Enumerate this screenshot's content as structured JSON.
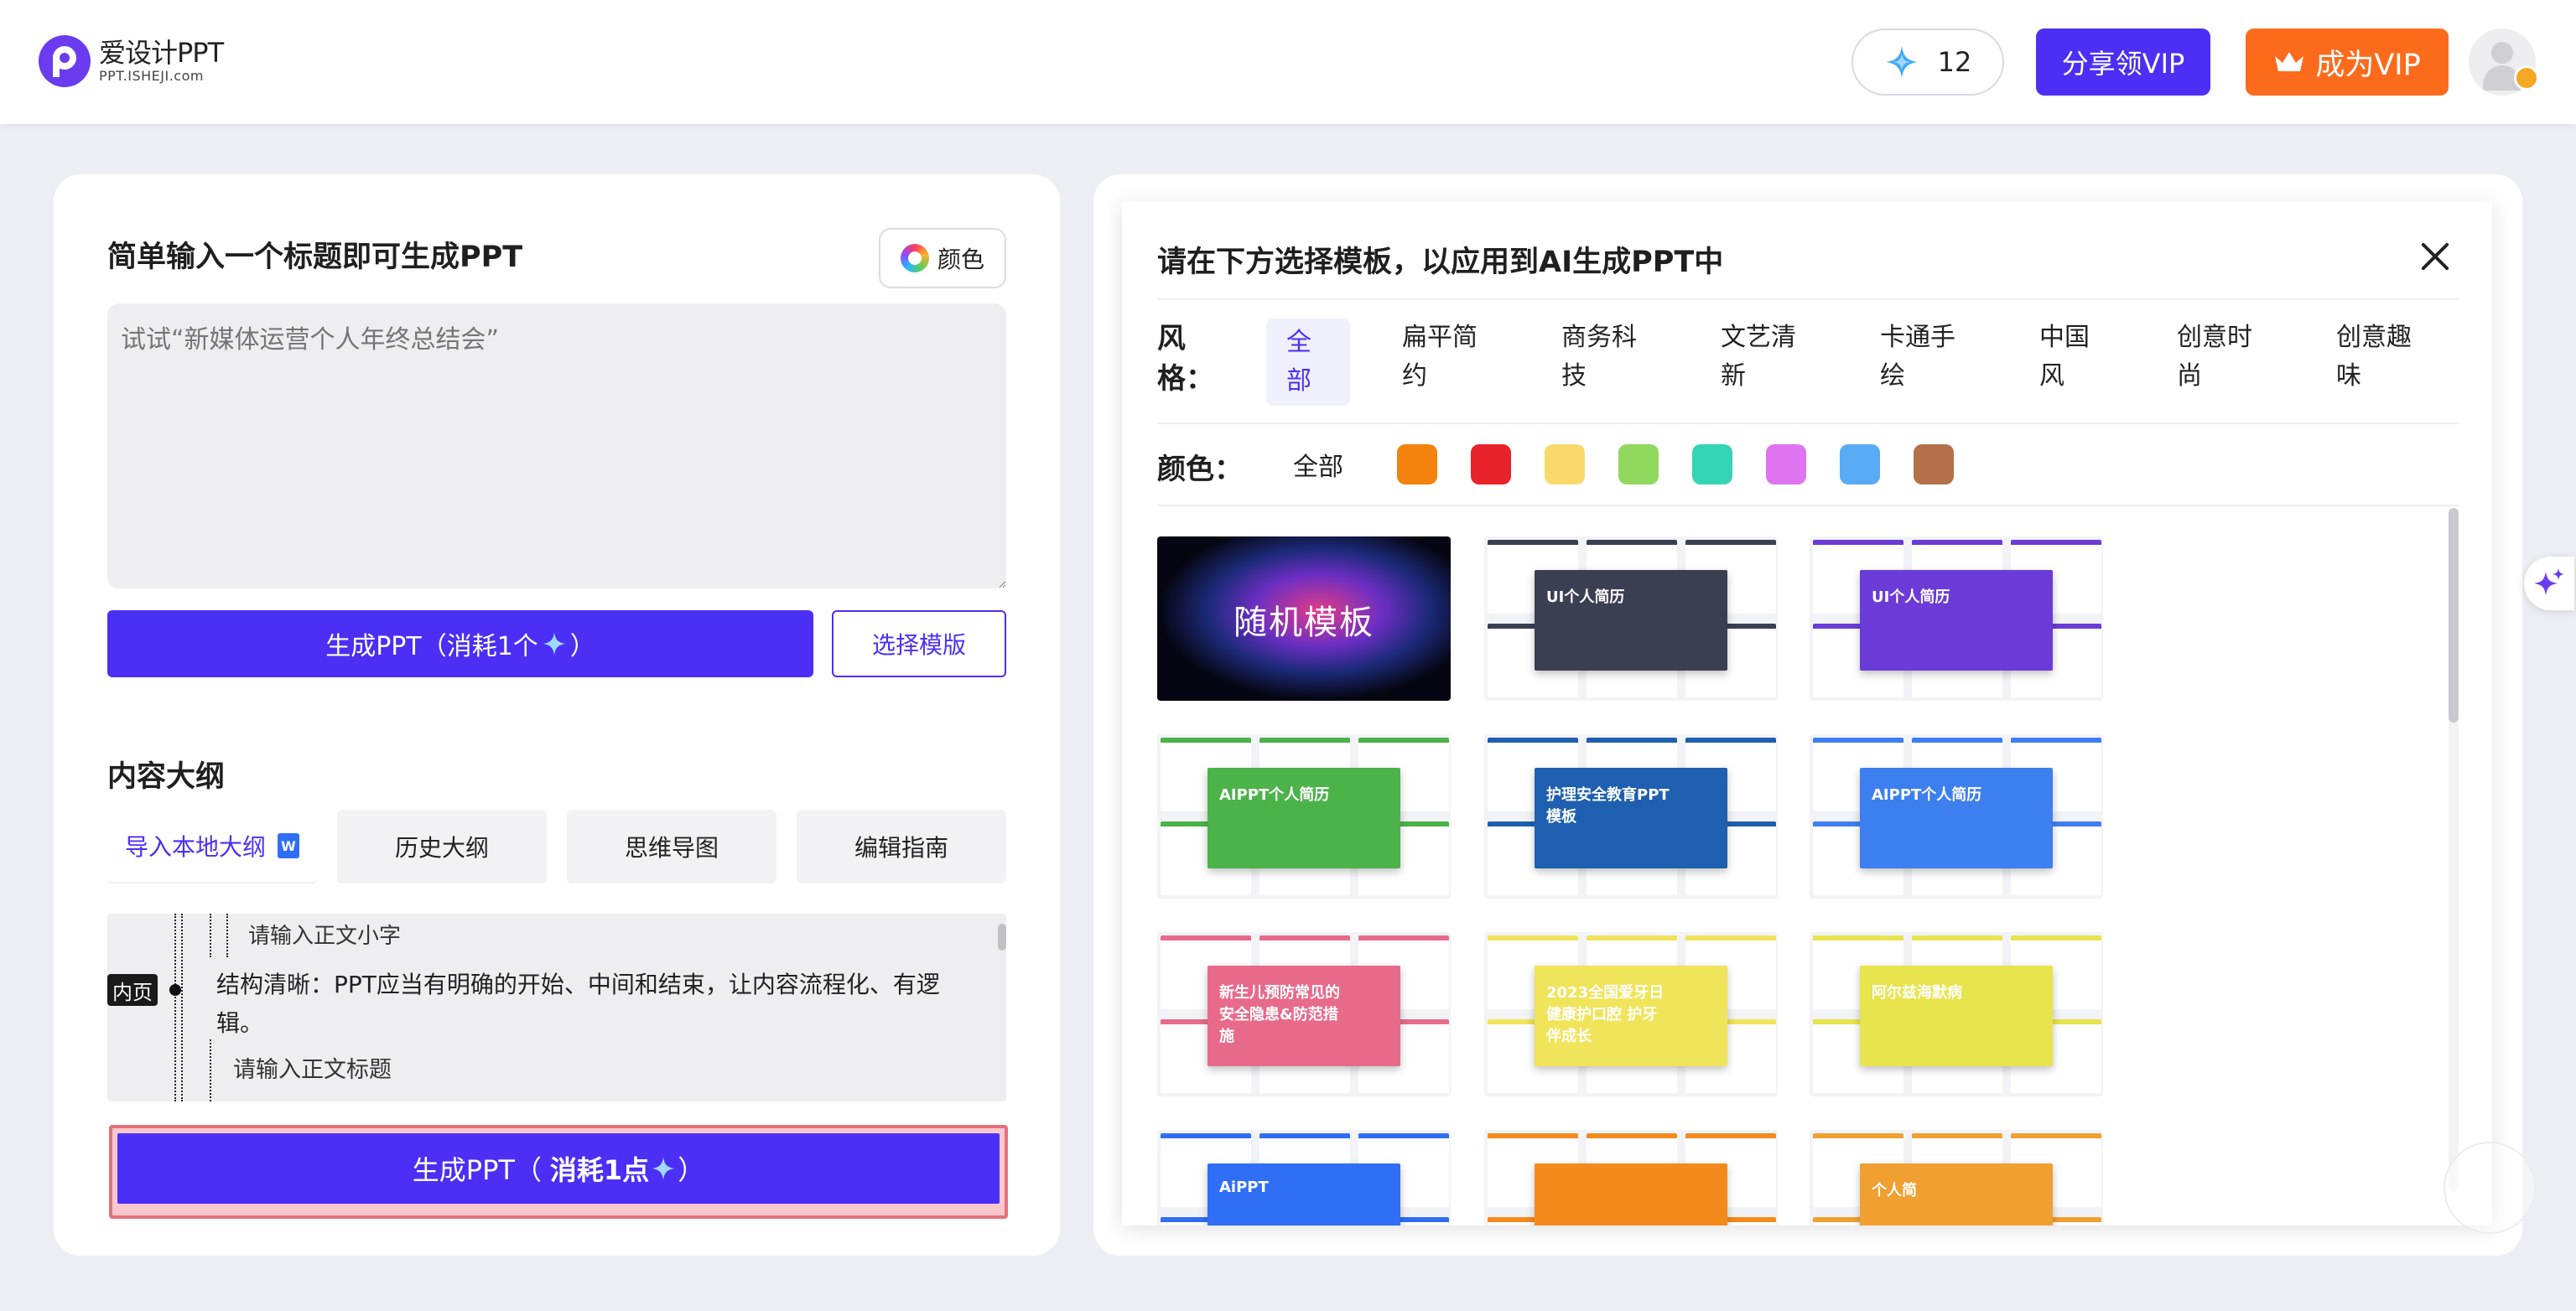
{
  "header": {
    "logo_title": "爱设计PPT",
    "logo_sub": "PPT.ISHEJI.com",
    "points": "12",
    "share_vip": "分享领VIP",
    "become_vip": "成为VIP"
  },
  "left": {
    "title": "简单输入一个标题即可生成PPT",
    "color_btn": "颜色",
    "topic_placeholder": "试试“新媒体运营个人年终总结会”",
    "gen_btn": "生成PPT（消耗1个",
    "gen_btn_tail": "）",
    "choose_tpl": "选择模版",
    "outline_title": "内容大纲",
    "outline_tabs": [
      "导入本地大纲",
      "历史大纲",
      "思维导图",
      "编辑指南"
    ],
    "outline": {
      "top_text": "请输入正文小字",
      "tag": "内页",
      "main_text": "结构清晰：PPT应当有明确的开始、中间和结束，让内容流程化、有逻辑。",
      "bottom_text": "请输入正文标题"
    },
    "gen_btn_2": "生成PPT（",
    "gen_btn_2_bold": "消耗1点",
    "gen_btn_2_tail": "）"
  },
  "modal": {
    "title": "请在下方选择模板，以应用到AI生成PPT中",
    "style_label": "风格：",
    "style_tabs": [
      "全部",
      "扁平简约",
      "商务科技",
      "文艺清新",
      "卡通手绘",
      "中国风",
      "创意时尚",
      "创意趣味"
    ],
    "color_label": "颜色：",
    "color_all": "全部",
    "swatches": [
      "#f4820f",
      "#e8222b",
      "#f9d96a",
      "#92d85e",
      "#34d5b4",
      "#de74f0",
      "#5aabf6",
      "#b4704a"
    ],
    "random_label": "随机模板",
    "templates": [
      {
        "label": "UI个人简历",
        "accent": "#3b3f52"
      },
      {
        "label": "UI个人简历",
        "accent": "#6b3bd8"
      },
      {
        "label": "AIPPT个人简历",
        "accent": "#4cb24a"
      },
      {
        "label": "护理安全教育PPT模板",
        "accent": "#1e5fb0"
      },
      {
        "label": "AIPPT个人简历",
        "accent": "#3e7ff0"
      },
      {
        "label": "新生儿预防常见的安全隐患&防范措施",
        "accent": "#e86a8a"
      },
      {
        "label": "2023全国爱牙日 健康护口腔 护牙伴成长",
        "accent": "#f0e45a"
      },
      {
        "label": "阿尔兹海默病",
        "accent": "#e8e44e"
      },
      {
        "label": "AiPPT",
        "accent": "#2f6ef5"
      },
      {
        "label": "",
        "accent": "#f58a1c"
      },
      {
        "label": "个人简",
        "accent": "#f0a030"
      }
    ]
  }
}
